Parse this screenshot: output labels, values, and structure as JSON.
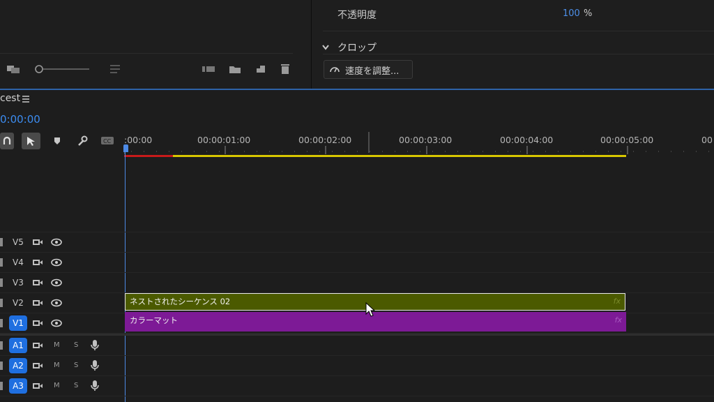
{
  "top_panel": {
    "opacity_label": "不透明度",
    "opacity_value": "100",
    "opacity_unit": "%",
    "crop_label": "クロップ",
    "speed_button_label": "速度を調整..."
  },
  "sequence": {
    "tab_name": "cest",
    "timecode": "0:00:00"
  },
  "ruler": {
    "ticks": [
      ":00:00",
      "00:00:01:00",
      "00:00:02:00",
      "00:00:03:00",
      "00:00:04:00",
      "00:00:05:00",
      "00"
    ]
  },
  "tracks": {
    "video": [
      {
        "name": "V5"
      },
      {
        "name": "V4"
      },
      {
        "name": "V3"
      },
      {
        "name": "V2"
      },
      {
        "name": "V1",
        "targeted": true
      }
    ],
    "audio": [
      {
        "name": "A1",
        "m": "M",
        "s": "S"
      },
      {
        "name": "A2",
        "m": "M",
        "s": "S"
      },
      {
        "name": "A3",
        "m": "M",
        "s": "S"
      }
    ]
  },
  "clips": {
    "nested": {
      "label": "ネストされたシーケンス 02",
      "fx": "fx",
      "color": "#4b5a00"
    },
    "matte": {
      "label": "カラーマット",
      "fx": "fx",
      "color": "#7d1a96"
    }
  },
  "colors": {
    "accent_blue": "#1f6fe0",
    "work_area_yellow": "#d8c700",
    "render_red": "#c81a1a",
    "playhead_blue": "#4d8ae6"
  }
}
